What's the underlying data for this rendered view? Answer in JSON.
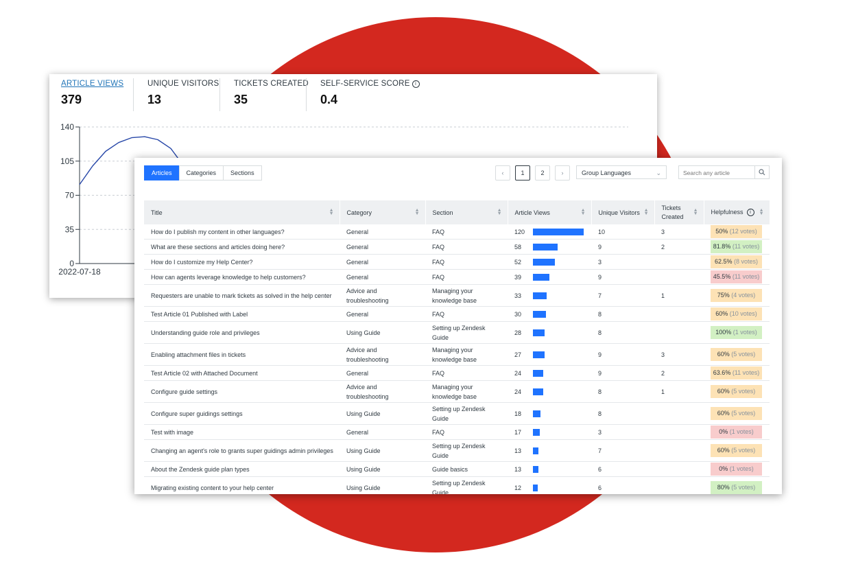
{
  "metrics": [
    {
      "label": "ARTICLE VIEWS",
      "value": "379",
      "active": true
    },
    {
      "label": "UNIQUE VISITORS",
      "value": "13"
    },
    {
      "label": "TICKETS CREATED",
      "value": "35"
    },
    {
      "label": "SELF-SERVICE SCORE",
      "value": "0.4",
      "info_icon": "info-icon"
    }
  ],
  "chart_data": {
    "type": "line",
    "title": "",
    "xlabel": "",
    "ylabel": "",
    "ylim": [
      0,
      140
    ],
    "y_ticks": [
      "0",
      "35",
      "70",
      "105",
      "140"
    ],
    "x_tick_labels": [
      "2022-07-18"
    ],
    "grid": "horizontal dashed",
    "series": [
      {
        "values": [
          81,
          100,
          115,
          124,
          129,
          130,
          127,
          118,
          100
        ]
      }
    ],
    "line_color": "#2747a8"
  },
  "tabs": [
    "Articles",
    "Categories",
    "Sections"
  ],
  "pagination": {
    "prev": "‹",
    "pages": [
      "1",
      "2"
    ],
    "current": "1",
    "next": "›"
  },
  "language_select": {
    "value": "Group Languages"
  },
  "search": {
    "placeholder": "Search any article",
    "icon": "search-icon"
  },
  "table": {
    "columns": [
      "Title",
      "Category",
      "Section",
      "Article Views",
      "Unique Visitors",
      "Tickets Created",
      "Helpfulness"
    ],
    "max_views": 120,
    "rows": [
      {
        "title": "How do I publish my content in other languages?",
        "category": "General",
        "section": "FAQ",
        "views": 120,
        "visitors": "10",
        "tickets": "3",
        "help_pct": "50%",
        "help_votes": "(12 votes)",
        "help_color": "orange"
      },
      {
        "title": "What are these sections and articles doing here?",
        "category": "General",
        "section": "FAQ",
        "views": 58,
        "visitors": "9",
        "tickets": "2",
        "help_pct": "81.8%",
        "help_votes": "(11 votes)",
        "help_color": "green"
      },
      {
        "title": "How do I customize my Help Center?",
        "category": "General",
        "section": "FAQ",
        "views": 52,
        "visitors": "3",
        "tickets": "",
        "help_pct": "62.5%",
        "help_votes": "(8 votes)",
        "help_color": "orange"
      },
      {
        "title": "How can agents leverage knowledge to help customers?",
        "category": "General",
        "section": "FAQ",
        "views": 39,
        "visitors": "9",
        "tickets": "",
        "help_pct": "45.5%",
        "help_votes": "(11 votes)",
        "help_color": "red"
      },
      {
        "title": "Requesters are unable to mark tickets as solved in the help center",
        "category": "Advice and troubleshooting",
        "section": "Managing your knowledge base",
        "views": 33,
        "visitors": "7",
        "tickets": "1",
        "help_pct": "75%",
        "help_votes": "(4 votes)",
        "help_color": "orange"
      },
      {
        "title": "Test Article 01 Published with Label",
        "category": "General",
        "section": "FAQ",
        "views": 30,
        "visitors": "8",
        "tickets": "",
        "help_pct": "60%",
        "help_votes": "(10 votes)",
        "help_color": "orange"
      },
      {
        "title": "Understanding guide role and privileges",
        "category": "Using Guide",
        "section": "Setting up Zendesk Guide",
        "views": 28,
        "visitors": "8",
        "tickets": "",
        "help_pct": "100%",
        "help_votes": "(1 votes)",
        "help_color": "green"
      },
      {
        "title": "Enabling attachment files in tickets",
        "category": "Advice and troubleshooting",
        "section": "Managing your knowledge base",
        "views": 27,
        "visitors": "9",
        "tickets": "3",
        "help_pct": "60%",
        "help_votes": "(5 votes)",
        "help_color": "orange"
      },
      {
        "title": "Test Article 02 with Attached Document",
        "category": "General",
        "section": "FAQ",
        "views": 24,
        "visitors": "9",
        "tickets": "2",
        "help_pct": "63.6%",
        "help_votes": "(11 votes)",
        "help_color": "orange"
      },
      {
        "title": "Configure guide settings",
        "category": "Advice and troubleshooting",
        "section": "Managing your knowledge base",
        "views": 24,
        "visitors": "8",
        "tickets": "1",
        "help_pct": "60%",
        "help_votes": "(5 votes)",
        "help_color": "orange"
      },
      {
        "title": "Configure super guidings settings",
        "category": "Using Guide",
        "section": "Setting up Zendesk Guide",
        "views": 18,
        "visitors": "8",
        "tickets": "",
        "help_pct": "60%",
        "help_votes": "(5 votes)",
        "help_color": "orange"
      },
      {
        "title": "Test with image",
        "category": "General",
        "section": "FAQ",
        "views": 17,
        "visitors": "3",
        "tickets": "",
        "help_pct": "0%",
        "help_votes": "(1 votes)",
        "help_color": "red"
      },
      {
        "title": "Changing an agent's role to grants super guidings admin privileges",
        "category": "Using Guide",
        "section": "Setting up Zendesk Guide",
        "views": 13,
        "visitors": "7",
        "tickets": "",
        "help_pct": "60%",
        "help_votes": "(5 votes)",
        "help_color": "orange"
      },
      {
        "title": "About the Zendesk guide plan types",
        "category": "Using Guide",
        "section": "Guide basics",
        "views": 13,
        "visitors": "6",
        "tickets": "",
        "help_pct": "0%",
        "help_votes": "(1 votes)",
        "help_color": "red"
      },
      {
        "title": "Migrating existing content to your help center",
        "category": "Using Guide",
        "section": "Setting up Zendesk Guide",
        "views": 12,
        "visitors": "6",
        "tickets": "",
        "help_pct": "80%",
        "help_votes": "(5 votes)",
        "help_color": "green"
      }
    ]
  }
}
